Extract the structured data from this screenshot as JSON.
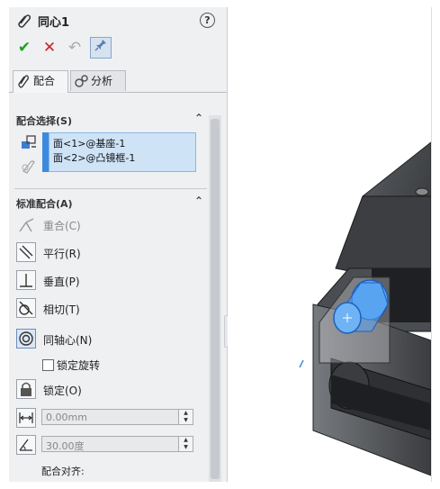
{
  "panel": {
    "title": "同心1",
    "help": "?",
    "actions": {
      "ok": "✔",
      "cancel": "✕",
      "undo": "↶",
      "pin": "📌"
    },
    "tabs": [
      {
        "label": "配合",
        "icon": "paperclip-icon"
      },
      {
        "label": "分析",
        "icon": "gears-icon"
      }
    ],
    "mate_selection": {
      "heading": "配合选择(S)",
      "items": [
        "面<1>@基座-1",
        "面<2>@凸镜框-1"
      ]
    },
    "standard_mates": {
      "heading": "标准配合(A)",
      "items": [
        {
          "label": "重合(C)",
          "icon": "coincident-icon",
          "enabled": false
        },
        {
          "label": "平行(R)",
          "icon": "parallel-icon",
          "enabled": true
        },
        {
          "label": "垂直(P)",
          "icon": "perpendicular-icon",
          "enabled": true
        },
        {
          "label": "相切(T)",
          "icon": "tangent-icon",
          "enabled": true
        },
        {
          "label": "同轴心(N)",
          "icon": "concentric-icon",
          "enabled": true,
          "selected": true
        }
      ],
      "lock_rotation": "锁定旋转",
      "lock": "锁定(O)",
      "distance": "0.00mm",
      "angle": "30.00度",
      "alignment": "配合对齐:"
    }
  },
  "colors": {
    "accent": "#3c8ae0",
    "panel_bg": "#eef0f2",
    "selection_bg": "#cfe3f7"
  }
}
